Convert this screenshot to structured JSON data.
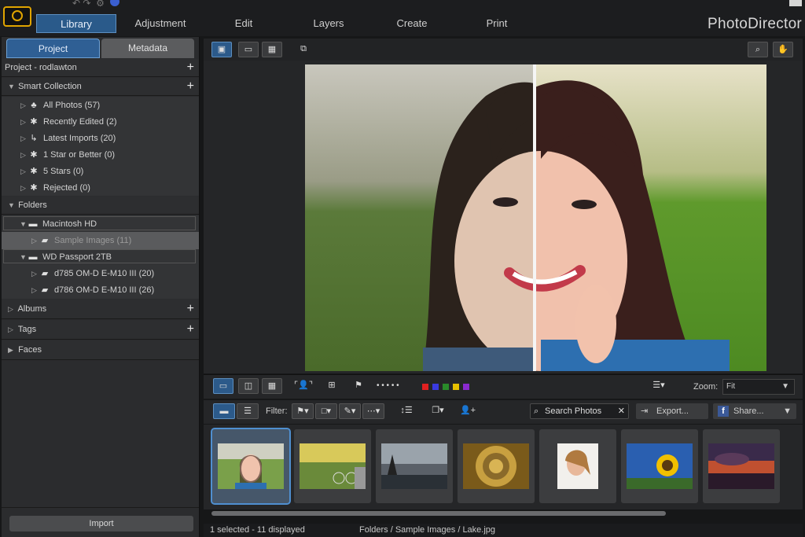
{
  "app": {
    "title": "PhotoDirector"
  },
  "topnav": {
    "tabs": [
      "Library",
      "Adjustment",
      "Edit",
      "Layers",
      "Create",
      "Print"
    ],
    "active": "Library"
  },
  "panel": {
    "tabs": [
      "Project",
      "Metadata"
    ],
    "project_label": "Project - rodlawton",
    "smart_collection": {
      "label": "Smart Collection",
      "items": [
        "All Photos (57)",
        "Recently Edited (2)",
        "Latest Imports (20)",
        "1 Star or Better (0)",
        "5 Stars (0)",
        "Rejected (0)"
      ]
    },
    "folders": {
      "label": "Folders",
      "drives": [
        {
          "name": "Macintosh HD",
          "children": [
            "Sample Images (11)"
          ]
        },
        {
          "name": "WD Passport 2TB",
          "children": [
            "d785 OM-D E-M10 III (20)",
            "d786 OM-D E-M10 III (26)"
          ]
        }
      ]
    },
    "albums_label": "Albums",
    "tags_label": "Tags",
    "faces_label": "Faces",
    "import_label": "Import"
  },
  "viewer": {
    "zoom_label": "Zoom:",
    "zoom_value": "Fit"
  },
  "filmbar": {
    "filter_label": "Filter:",
    "search_label": "Search Photos",
    "export_label": "Export...",
    "share_label": "Share...",
    "dots": "• • • • •"
  },
  "color_labels": [
    "#e02020",
    "#3a3ae0",
    "#2a8a2a",
    "#e6c000",
    "#8a2ad0"
  ],
  "status": {
    "selection": "1 selected - 11 displayed",
    "path": "Folders / Sample Images / Lake.jpg"
  }
}
